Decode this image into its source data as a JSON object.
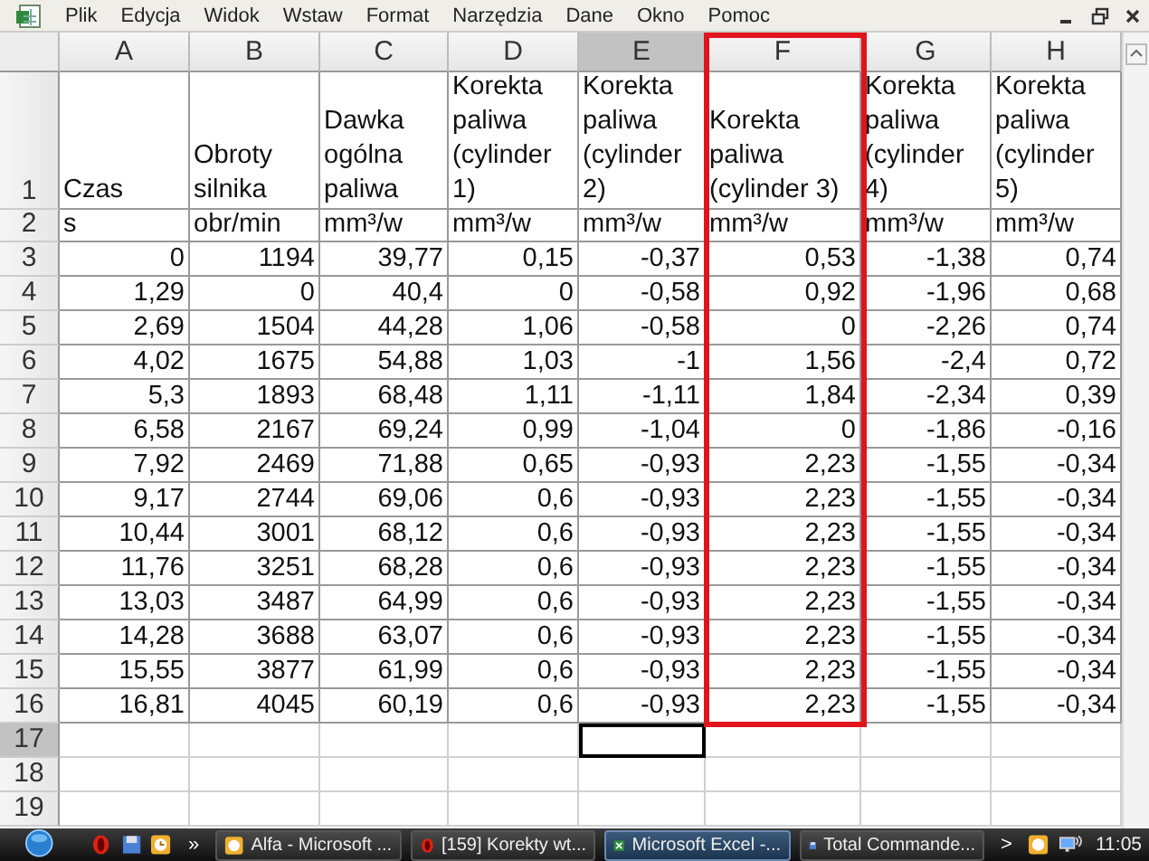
{
  "menu": [
    "Plik",
    "Edycja",
    "Widok",
    "Wstaw",
    "Format",
    "Narzędzia",
    "Dane",
    "Okno",
    "Pomoc"
  ],
  "columns": [
    {
      "letter": "A",
      "selected": false,
      "framed": false
    },
    {
      "letter": "B",
      "selected": false,
      "framed": false
    },
    {
      "letter": "C",
      "selected": false,
      "framed": false
    },
    {
      "letter": "D",
      "selected": false,
      "framed": false
    },
    {
      "letter": "E",
      "selected": true,
      "framed": false
    },
    {
      "letter": "F",
      "selected": false,
      "framed": true
    },
    {
      "letter": "G",
      "selected": false,
      "framed": false
    },
    {
      "letter": "H",
      "selected": false,
      "framed": false
    }
  ],
  "rows": [
    {
      "number": "1",
      "kind": "header",
      "selected": false,
      "cells": [
        "Czas",
        "Obroty silnika",
        "Dawka ogólna paliwa",
        "Korekta paliwa (cylinder 1)",
        "Korekta paliwa (cylinder 2)",
        "Korekta paliwa (cylinder 3)",
        "Korekta paliwa (cylinder 4)",
        "Korekta paliwa (cylinder 5)"
      ]
    },
    {
      "number": "2",
      "kind": "units",
      "selected": false,
      "cells": [
        "s",
        "obr/min",
        "mm³/w",
        "mm³/w",
        "mm³/w",
        "mm³/w",
        "mm³/w",
        "mm³/w"
      ]
    },
    {
      "number": "3",
      "kind": "numbers",
      "selected": false,
      "cells": [
        "0",
        "1194",
        "39,77",
        "0,15",
        "-0,37",
        "0,53",
        "-1,38",
        "0,74"
      ]
    },
    {
      "number": "4",
      "kind": "numbers",
      "selected": false,
      "cells": [
        "1,29",
        "0",
        "40,4",
        "0",
        "-0,58",
        "0,92",
        "-1,96",
        "0,68"
      ]
    },
    {
      "number": "5",
      "kind": "numbers",
      "selected": false,
      "cells": [
        "2,69",
        "1504",
        "44,28",
        "1,06",
        "-0,58",
        "0",
        "-2,26",
        "0,74"
      ]
    },
    {
      "number": "6",
      "kind": "numbers",
      "selected": false,
      "cells": [
        "4,02",
        "1675",
        "54,88",
        "1,03",
        "-1",
        "1,56",
        "-2,4",
        "0,72"
      ]
    },
    {
      "number": "7",
      "kind": "numbers",
      "selected": false,
      "cells": [
        "5,3",
        "1893",
        "68,48",
        "1,11",
        "-1,11",
        "1,84",
        "-2,34",
        "0,39"
      ]
    },
    {
      "number": "8",
      "kind": "numbers",
      "selected": false,
      "cells": [
        "6,58",
        "2167",
        "69,24",
        "0,99",
        "-1,04",
        "0",
        "-1,86",
        "-0,16"
      ]
    },
    {
      "number": "9",
      "kind": "numbers",
      "selected": false,
      "cells": [
        "7,92",
        "2469",
        "71,88",
        "0,65",
        "-0,93",
        "2,23",
        "-1,55",
        "-0,34"
      ]
    },
    {
      "number": "10",
      "kind": "numbers",
      "selected": false,
      "cells": [
        "9,17",
        "2744",
        "69,06",
        "0,6",
        "-0,93",
        "2,23",
        "-1,55",
        "-0,34"
      ]
    },
    {
      "number": "11",
      "kind": "numbers",
      "selected": false,
      "cells": [
        "10,44",
        "3001",
        "68,12",
        "0,6",
        "-0,93",
        "2,23",
        "-1,55",
        "-0,34"
      ]
    },
    {
      "number": "12",
      "kind": "numbers",
      "selected": false,
      "cells": [
        "11,76",
        "3251",
        "68,28",
        "0,6",
        "-0,93",
        "2,23",
        "-1,55",
        "-0,34"
      ]
    },
    {
      "number": "13",
      "kind": "numbers",
      "selected": false,
      "cells": [
        "13,03",
        "3487",
        "64,99",
        "0,6",
        "-0,93",
        "2,23",
        "-1,55",
        "-0,34"
      ]
    },
    {
      "number": "14",
      "kind": "numbers",
      "selected": false,
      "cells": [
        "14,28",
        "3688",
        "63,07",
        "0,6",
        "-0,93",
        "2,23",
        "-1,55",
        "-0,34"
      ]
    },
    {
      "number": "15",
      "kind": "numbers",
      "selected": false,
      "cells": [
        "15,55",
        "3877",
        "61,99",
        "0,6",
        "-0,93",
        "2,23",
        "-1,55",
        "-0,34"
      ]
    },
    {
      "number": "16",
      "kind": "numbers",
      "selected": false,
      "cells": [
        "16,81",
        "4045",
        "60,19",
        "0,6",
        "-0,93",
        "2,23",
        "-1,55",
        "-0,34"
      ]
    },
    {
      "number": "17",
      "kind": "numbers",
      "selected": true
    },
    {
      "number": "18",
      "kind": "numbers",
      "selected": false
    },
    {
      "number": "19",
      "kind": "numbers",
      "selected": false
    }
  ],
  "taskbar": {
    "quick_launch": [
      {
        "kind": "red"
      },
      {
        "kind": "blue"
      },
      {
        "kind": "clock"
      }
    ],
    "overflow": "»",
    "tasks": [
      {
        "label": "Alfa - Microsoft ...",
        "kind": "clock",
        "selected": false
      },
      {
        "label": "[159] Korekty wt...",
        "kind": "red",
        "selected": false
      },
      {
        "label": "Microsoft Excel -...",
        "kind": "excel",
        "selected": true
      },
      {
        "label": "Total Commande...",
        "kind": "blue",
        "selected": false
      }
    ],
    "tray_toggle": ">",
    "clock": "11:05"
  }
}
